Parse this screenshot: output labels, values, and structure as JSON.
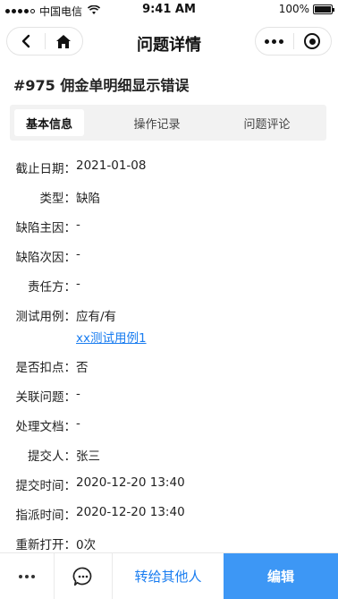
{
  "status_bar": {
    "carrier": "中国电信",
    "time": "9:41 AM",
    "battery_text": "100%",
    "battery_level": 1.0
  },
  "nav": {
    "title": "问题详情",
    "back_icon": "chevron-left-icon",
    "home_icon": "home-icon",
    "more_icon": "more-dots-icon",
    "target_icon": "target-icon"
  },
  "issue": {
    "title": "#975 佣金单明细显示错误"
  },
  "tabs": [
    {
      "label": "基本信息",
      "active": true
    },
    {
      "label": "操作记录",
      "active": false
    },
    {
      "label": "问题评论",
      "active": false
    }
  ],
  "fields": {
    "deadline": {
      "label": "截止日期：",
      "value": "2021-01-08"
    },
    "type": {
      "label": "类型：",
      "value": "缺陷"
    },
    "primary_cause": {
      "label": "缺陷主因：",
      "value": "-"
    },
    "secondary_cause": {
      "label": "缺陷次因：",
      "value": "-"
    },
    "responsible": {
      "label": "责任方：",
      "value": "-"
    },
    "test_case": {
      "label": "测试用例：",
      "value": "应有/有",
      "link": "xx测试用例1"
    },
    "deduction": {
      "label": "是否扣点：",
      "value": "否"
    },
    "related": {
      "label": "关联问题：",
      "value": "-"
    },
    "doc": {
      "label": "处理文档：",
      "value": "-"
    },
    "submitter": {
      "label": "提交人：",
      "value": "张三"
    },
    "submit_time": {
      "label": "提交时间：",
      "value": "2020-12-20 13:40"
    },
    "assign_time": {
      "label": "指派时间：",
      "value": "2020-12-20 13:40"
    },
    "reopen": {
      "label": "重新打开：",
      "value": "0次"
    }
  },
  "bottom_bar": {
    "transfer_label": "转给其他人",
    "edit_label": "编辑"
  },
  "colors": {
    "accent": "#3d97f5",
    "link": "#1a7df0"
  }
}
